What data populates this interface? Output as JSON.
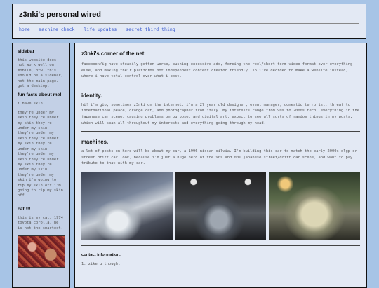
{
  "header": {
    "title": "z3nki's personal wired",
    "nav": [
      "home",
      "machine check",
      "life updates",
      "secret third thing"
    ]
  },
  "sidebar": {
    "heading": "sidebar",
    "notice": "this website does not work well on mobile, btw. this should be a sidebar, not the main page. get a desktop.",
    "fun_facts_heading": "fun facts about me!",
    "fact_1": "i have skin.",
    "fact_2": "they're under my skin they're under my skin they're under my skin they're under my skin they're under my skin they're under my skin they're under my skin they're under my skin they're under my skin they're under my skin i'm going to rip my skin off i'm going to rip my skin off",
    "cat_heading": "cat !!!",
    "cat_text": "this is my cat, 1974 toyota corolla. he is not the smartest."
  },
  "main": {
    "corner_heading": "z3nki's corner of the net.",
    "corner_text": "facebook/ig have steadily gotten worse, pushing excessive ads, forcing the reel/short form video format over everything else, and making their platforms not independent content creator friendly. so i've decided to make a website instead, where i have total control over what i post.",
    "identity_heading": "identity.",
    "identity_text": "hi! i'm gio, sometimes z3nki on the internet. i'm a 27 year old designer, event manager, domestic terrorist, threat to international peace, orange cat, and photographer from italy. my interests range from 90s to 2000s tech, everything in the japanese car scene, causing problems on purpose, and digital art. expect to see all sorts of random things in my posts, which will span all throughout my interests and everything going through my head.",
    "machines_heading": "machines.",
    "machines_text": "a lot of posts on here will be about my car, a 1996 nissan silvia. I'm building this car to match the early 2000s dlgp or street drift car look, because i'm just a huge nerd of the 90s and 00s japanese street/drift car scene, and want to pay tribute to that with my car.",
    "contact_heading": "contact information.",
    "contact_items": [
      "1. zike u thought"
    ]
  }
}
